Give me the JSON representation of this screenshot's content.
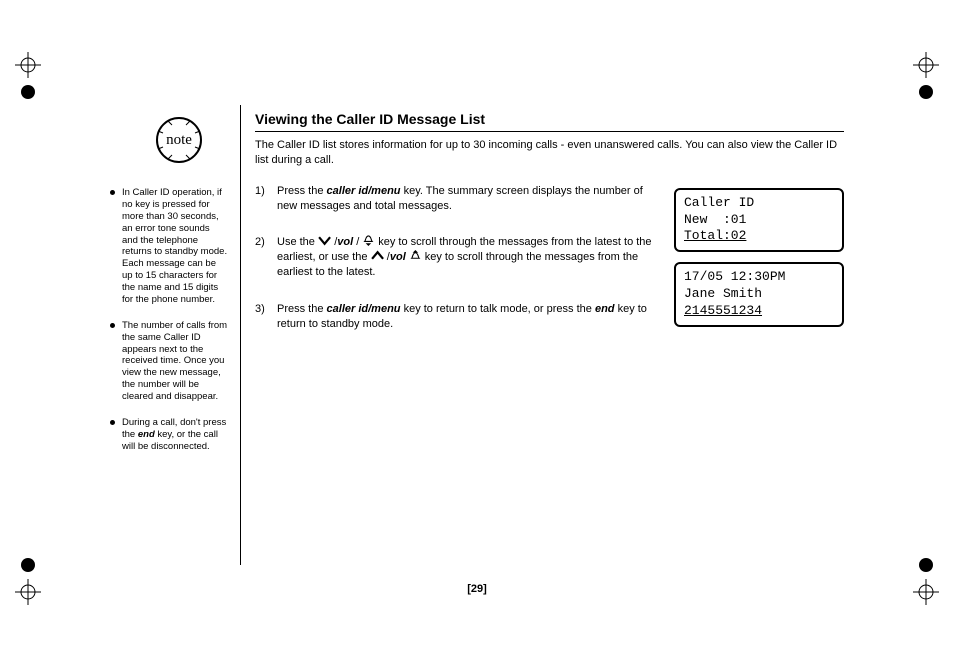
{
  "note_label": "note",
  "sidebar": {
    "items": [
      "In Caller ID operation, if no key is pressed for more than 30 seconds, an error tone sounds and the  telephone returns to standby mode.\nEach message can be up to 15 characters for the name and 15 digits for the phone number.",
      "The number of calls from the same Caller ID appears next to the received time. Once you view the new message, the number will be cleared and disappear.",
      "During a call, don't press the |end| key, or the call will be disconnected."
    ]
  },
  "heading": "Viewing the Caller ID Message List",
  "intro": "The Caller ID list stores information for up to 30 incoming calls - even unanswered calls. You can also view the Caller ID list during a call.",
  "steps": [
    {
      "n": "1)",
      "html": "Press the |caller id/menu| key. The summary screen displays the number of new messages and total messages."
    },
    {
      "n": "2)",
      "html": "Use the [down] /|vol| / [ring-down] key to scroll through the messages from the latest to the earliest, or use the [up] /|vol| [ring-up]  key to scroll through the messages from the earliest to the latest."
    },
    {
      "n": "3)",
      "html": "Press the |caller id/menu| key to return to talk mode, or press the |end| key to return to standby mode."
    }
  ],
  "lcd1": {
    "line1": "Caller ID",
    "line2": "New  :01",
    "line3": "Total:02"
  },
  "lcd2": {
    "line1": "17/05 12:30PM",
    "line2": "Jane Smith",
    "line3": "2145551234"
  },
  "page_number": "[29]"
}
